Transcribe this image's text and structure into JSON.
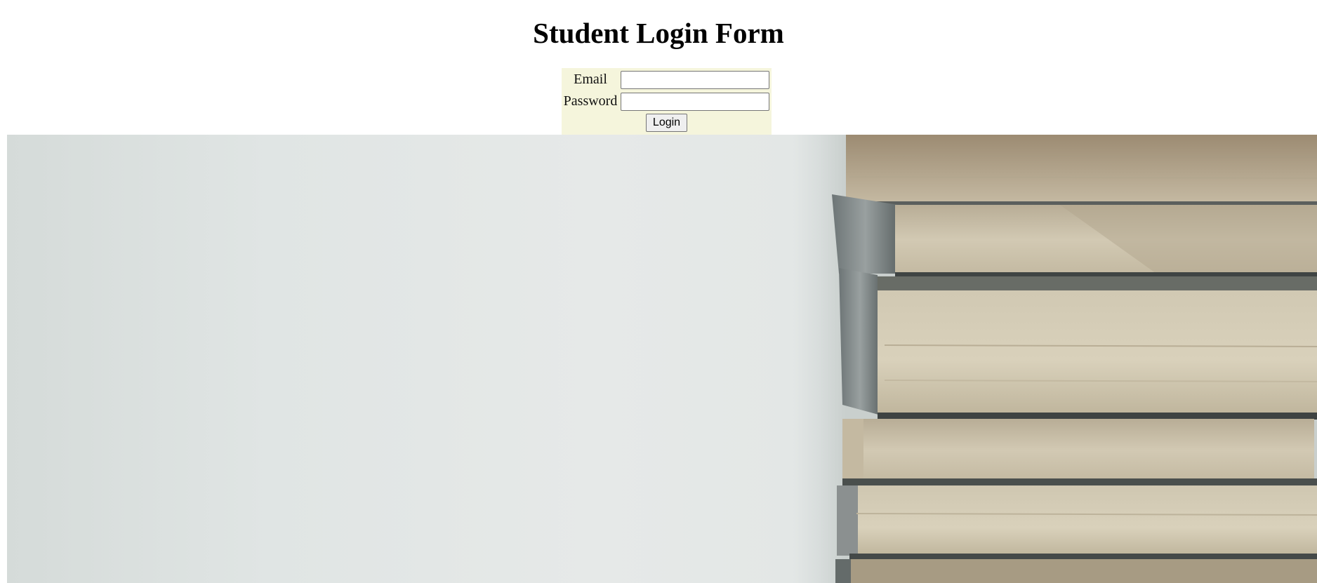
{
  "page": {
    "title": "Student Login Form"
  },
  "form": {
    "email_label": "Email",
    "email_value": "",
    "password_label": "Password",
    "password_value": "",
    "login_label": "Login",
    "background_color": "#f5f5dc"
  },
  "hero": {
    "image_subject": "stack-of-books-photo",
    "wall_color": "#e4e8e7",
    "page_color": "#cfc6b0",
    "spine_color": "#8d9495"
  }
}
